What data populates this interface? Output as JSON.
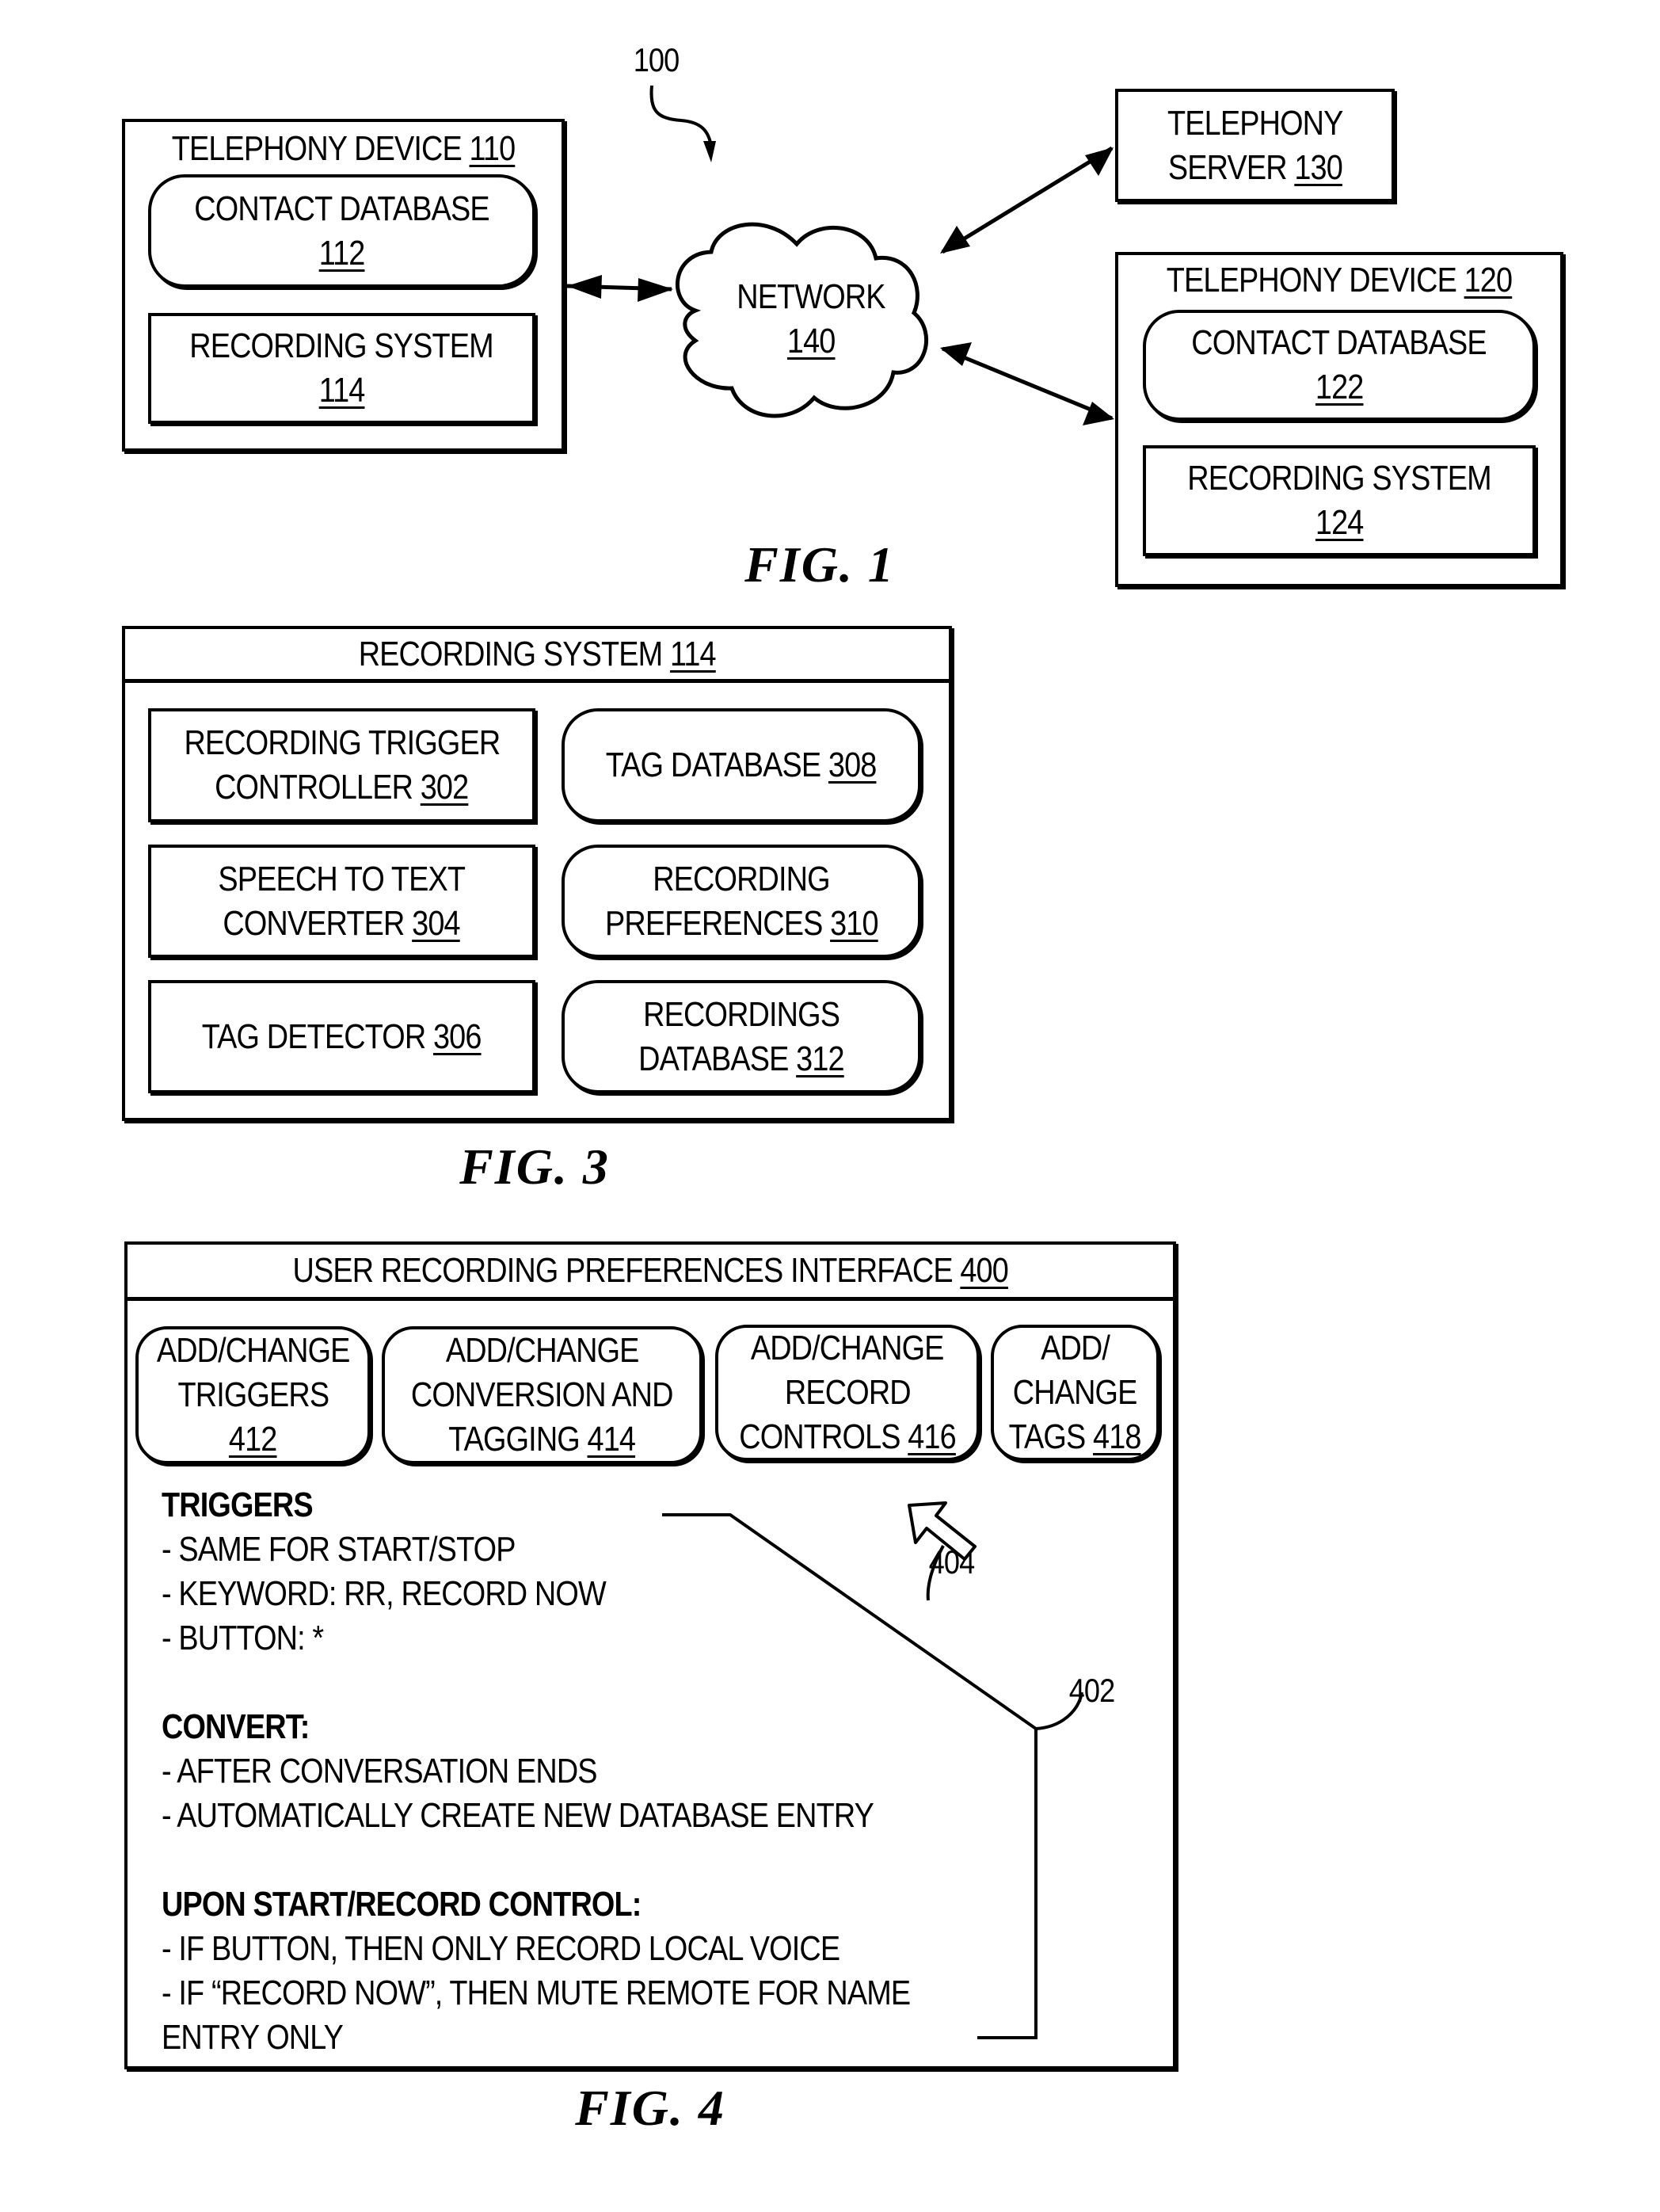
{
  "fig1": {
    "ref_label": "100",
    "caption": "FIG. 1",
    "device_110": {
      "title": "TELEPHONY DEVICE ",
      "num": "110",
      "contact_db": {
        "title": "CONTACT DATABASE",
        "num": "112"
      },
      "recording_system": {
        "title": "RECORDING SYSTEM",
        "num": "114"
      }
    },
    "network": {
      "title": "NETWORK",
      "num": "140"
    },
    "server": {
      "line1": "TELEPHONY",
      "line2": "SERVER ",
      "num": "130"
    },
    "device_120": {
      "title": "TELEPHONY DEVICE ",
      "num": "120",
      "contact_db": {
        "title": "CONTACT DATABASE",
        "num": "122"
      },
      "recording_system": {
        "title": "RECORDING SYSTEM",
        "num": "124"
      }
    }
  },
  "fig3": {
    "caption": "FIG. 3",
    "header": {
      "title": "RECORDING SYSTEM ",
      "num": "114"
    },
    "components": [
      {
        "line1": "RECORDING TRIGGER",
        "line2": "CONTROLLER ",
        "num": "302",
        "shape": "rect"
      },
      {
        "line1": "",
        "line2": "TAG DATABASE ",
        "num": "308",
        "shape": "rounded"
      },
      {
        "line1": "SPEECH TO TEXT",
        "line2": "CONVERTER  ",
        "num": "304",
        "shape": "rect"
      },
      {
        "line1": "RECORDING",
        "line2": "PREFERENCES  ",
        "num": "310",
        "shape": "rounded"
      },
      {
        "line1": "",
        "line2": "TAG DETECTOR ",
        "num": "306",
        "shape": "rect"
      },
      {
        "line1": "RECORDINGS",
        "line2": "DATABASE  ",
        "num": "312",
        "shape": "rounded"
      }
    ]
  },
  "fig4": {
    "caption": "FIG. 4",
    "header": {
      "title": "USER RECORDING PREFERENCES INTERFACE ",
      "num": "400"
    },
    "buttons": [
      {
        "line1": "ADD/CHANGE",
        "line2": "TRIGGERS",
        "line3": "",
        "num": "412"
      },
      {
        "line1": "ADD/CHANGE",
        "line2": "CONVERSION AND",
        "line3": "TAGGING  ",
        "num": "414"
      },
      {
        "line1": "ADD/CHANGE",
        "line2": "RECORD",
        "line3": "CONTROLS ",
        "num": "416"
      },
      {
        "line1": "ADD/",
        "line2": "CHANGE",
        "line3": "TAGS ",
        "num": "418"
      }
    ],
    "pointer_ref": "404",
    "settings_ref": "402",
    "settings": [
      {
        "text": "TRIGGERS",
        "bold": true
      },
      {
        "text": "- SAME FOR START/STOP",
        "bold": false
      },
      {
        "text": "- KEYWORD: RR, RECORD NOW",
        "bold": false
      },
      {
        "text": "- BUTTON: *",
        "bold": false
      },
      {
        "text": "CONVERT:",
        "bold": true
      },
      {
        "text": "- AFTER CONVERSATION ENDS",
        "bold": false
      },
      {
        "text": "- AUTOMATICALLY CREATE NEW DATABASE ENTRY",
        "bold": false
      },
      {
        "text": "UPON START/RECORD CONTROL:",
        "bold": true
      },
      {
        "text": "- IF BUTTON, THEN ONLY RECORD LOCAL VOICE",
        "bold": false
      },
      {
        "text": "- IF “RECORD NOW”, THEN MUTE REMOTE FOR NAME",
        "bold": false
      },
      {
        "text": "ENTRY ONLY",
        "bold": false
      }
    ]
  }
}
